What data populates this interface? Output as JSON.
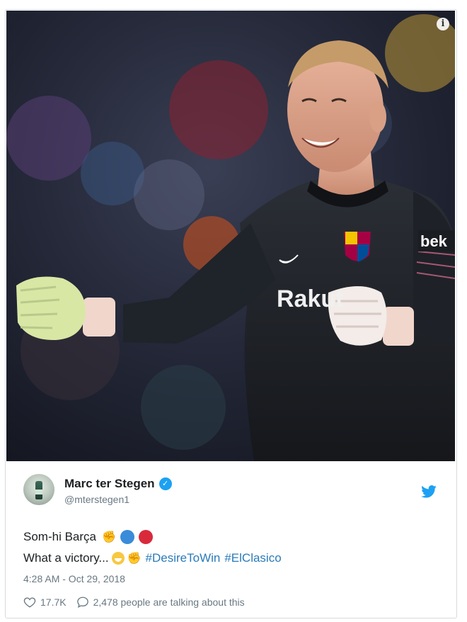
{
  "tweet": {
    "display_name": "Marc ter Stegen",
    "handle": "@mterstegen1",
    "line1_text": "Som-hi Barça",
    "line2_text": "What a victory...",
    "hashtag1": "#DesireToWin",
    "hashtag2": "#ElClasico",
    "timestamp": "4:28 AM - Oct 29, 2018",
    "likes": "17.7K",
    "talking": "2,478 people are talking about this"
  },
  "photo": {
    "jersey_text": "Rakut",
    "sleeve_text": "bek"
  },
  "icons": {
    "info": "i",
    "verified": "✓"
  },
  "colors": {
    "twitter_blue": "#1da1f2",
    "link": "#2b7bb9",
    "muted": "#697882"
  }
}
